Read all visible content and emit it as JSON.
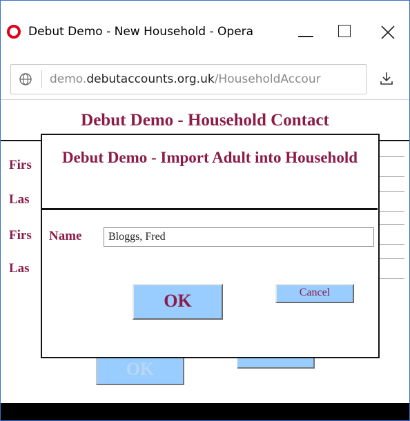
{
  "window": {
    "title": "Debut Demo - New Household - Opera",
    "controls": {
      "minimize_icon": "minimize-icon",
      "maximize_icon": "maximize-icon",
      "close_icon": "close-icon"
    }
  },
  "address_bar": {
    "url_prefix": "demo.",
    "url_domain": "debutaccounts.org.uk",
    "url_path": "/HouseholdAccour",
    "site_icon": "globe-icon",
    "download_icon": "download-icon"
  },
  "page": {
    "title": "Debut Demo - Household Contact",
    "labels": [
      "Firs",
      "Las",
      "Firs",
      "Las"
    ],
    "ok_label": "OK",
    "cancel_label": ""
  },
  "modal": {
    "title": "Debut Demo - Import Adult into Household",
    "name_label": "Name",
    "name_value": "Bloggs, Fred",
    "ok_label": "OK",
    "cancel_label": "Cancel"
  },
  "colors": {
    "heading": "#8b1c48",
    "button_fill": "#99ccff",
    "window_border": "#3b6fc9",
    "opera_red": "#e0001a"
  }
}
